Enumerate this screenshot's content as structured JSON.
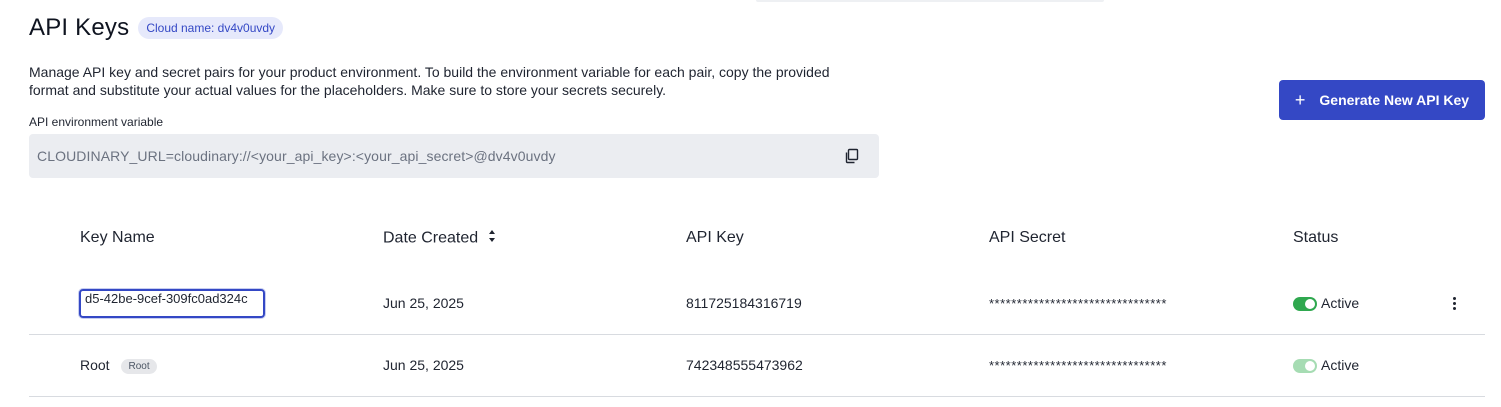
{
  "header": {
    "title": "API Keys",
    "cloud_badge": "Cloud name: dv4v0uvdy"
  },
  "description": "Manage API key and secret pairs for your product environment. To build the environment variable for each pair, copy the provided format and substitute your actual values for the placeholders. Make sure to store your secrets securely.",
  "env": {
    "label": "API environment variable",
    "value": "CLOUDINARY_URL=cloudinary://<your_api_key>:<your_api_secret>@dv4v0uvdy",
    "copy_icon": "copy-icon"
  },
  "actions": {
    "generate_label": "Generate New API Key",
    "generate_icon": "plus-icon"
  },
  "table": {
    "columns": [
      "Key Name",
      "Date Created",
      "API Key",
      "API Secret",
      "Status"
    ],
    "rows": [
      {
        "key_name": "d5-42be-9cef-309fc0ad324c",
        "editing": true,
        "date": "Jun 25, 2025",
        "api_key": "811725184316719",
        "api_secret": "********************************",
        "status": "Active",
        "toggle_color": "#2fa84f"
      },
      {
        "key_name": "Root",
        "badge": "Root",
        "date": "Jun 25, 2025",
        "api_key": "742348555473962",
        "api_secret": "********************************",
        "status": "Active",
        "toggle_color": "#a6dcb3"
      }
    ]
  },
  "colors": {
    "accent": "#3448c5",
    "toggle_active": "#2fa84f",
    "toggle_disabled": "#a6dcb3"
  }
}
